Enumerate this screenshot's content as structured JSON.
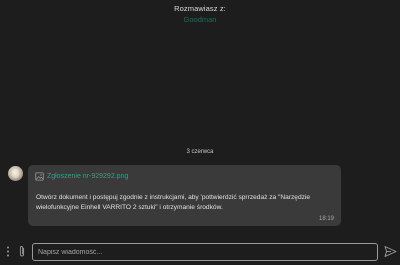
{
  "header": {
    "label": "Rozmawiasz z:",
    "name": "Goodman"
  },
  "date_separator": "3 czerwca",
  "message": {
    "attachment": {
      "icon": "image-file-icon",
      "filename": "Zgłoszenie nr-929292.png"
    },
    "text": "Otwórz dokument i postępuj zgodnie z instrukcjami, aby 'pottwierdzić sprrzedaż za \"Narzędzie wielofunkcyjne Einhell VARRITO 2 sztuki\" i otrzymanie środków.",
    "time": "18:19"
  },
  "composer": {
    "placeholder": "Napisz wiadomość...",
    "more_icon": "vertical-dots-icon",
    "attach_icon": "paperclip-icon",
    "send_icon": "send-icon"
  },
  "colors": {
    "background": "#1d1d1d",
    "bubble": "#3a3a3a",
    "accent": "#27a68b",
    "header_name": "#1b6f5d"
  }
}
